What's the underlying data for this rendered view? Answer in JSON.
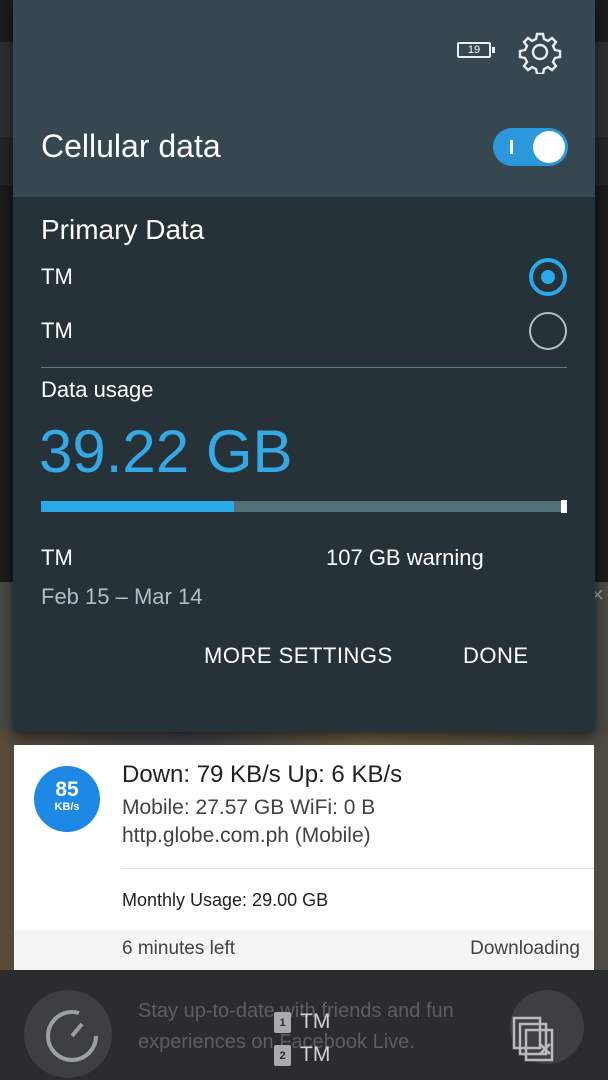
{
  "quick_settings": {
    "battery_level": "19",
    "title": "Cellular data",
    "toggle_on": true,
    "primary_data_label": "Primary Data",
    "sims": [
      {
        "name": "TM",
        "selected": true
      },
      {
        "name": "TM",
        "selected": false
      }
    ],
    "usage_label": "Data usage",
    "usage_value": "39.22 GB",
    "usage_fraction": 0.366,
    "carrier": "TM",
    "warning_text": "107 GB warning",
    "period": "Feb 15 – Mar 14",
    "more_settings_label": "MORE SETTINGS",
    "done_label": "DONE",
    "colors": {
      "accent": "#29a9e7",
      "panel": "#263238",
      "header": "#37474f"
    }
  },
  "notification": {
    "badge_number": "85",
    "badge_unit": "KB/s",
    "line1": "Down: 79 KB/s  Up: 6 KB/s",
    "line2": "Mobile: 27.57 GB  WiFi: 0 B",
    "line3": "http.globe.com.ph (Mobile)",
    "monthly": "Monthly Usage: 29.00 GB"
  },
  "download_notification": {
    "time_left": "6 minutes left",
    "status": "Downloading"
  },
  "background": {
    "facebook_text": "Stay up-to-date with friends and fun experiences on Facebook Live.",
    "sim_indicators": [
      {
        "slot": "1",
        "label": "TM"
      },
      {
        "slot": "2",
        "label": "TM"
      }
    ]
  },
  "icons": [
    "battery-icon",
    "gear-icon",
    "refresh-icon",
    "arrow-right-icon",
    "recent-apps-icon",
    "close-icon"
  ]
}
